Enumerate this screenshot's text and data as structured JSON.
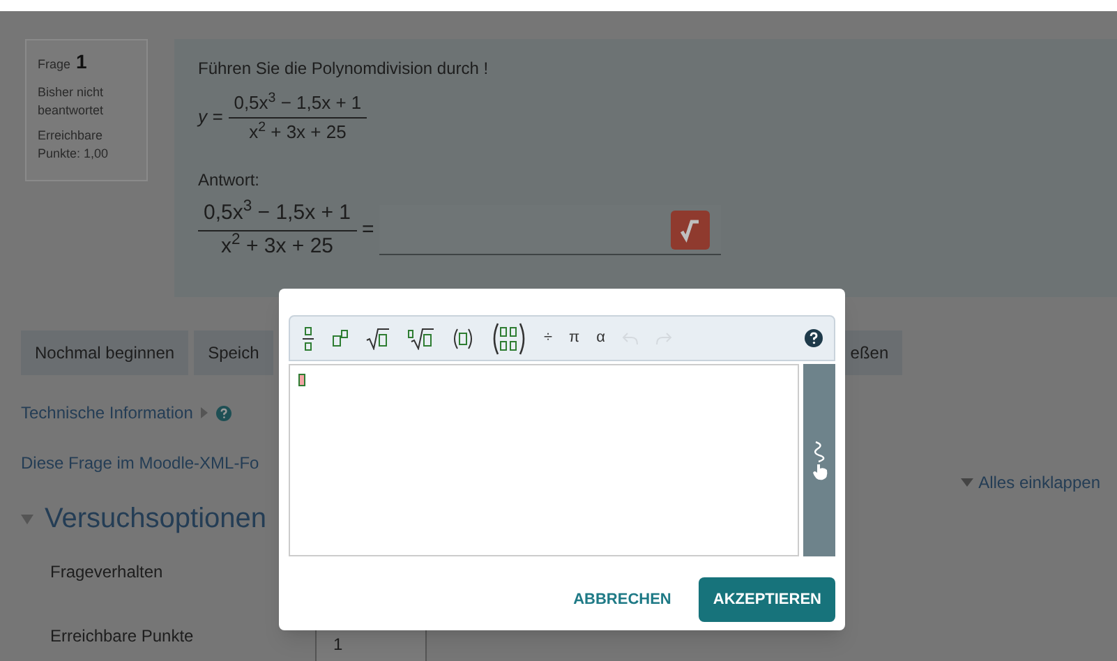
{
  "question_info": {
    "label": "Frage",
    "number": "1",
    "status": "Bisher nicht beantwortet",
    "points": "Erreichbare Punkte: 1,00"
  },
  "question": {
    "prompt": "Führen Sie die Polynomdivision durch !",
    "formula": {
      "lhs": "y =",
      "numerator": "0,5x$^{3}$ − 1,5x + 1",
      "denominator": "x$^{2}$ + 3x + 25"
    },
    "answer_label": "Antwort:",
    "answer_formula": {
      "numerator": "0,5x$^{3}$ − 1,5x + 1",
      "denominator": "x$^{2}$ + 3x + 25",
      "rhs": "="
    }
  },
  "action_buttons": [
    {
      "label": "Nochmal beginnen"
    },
    {
      "label": "Speich"
    },
    {
      "label": "eßen"
    }
  ],
  "links": [
    {
      "label": "Technische Information",
      "kind": "expander"
    },
    {
      "label": "Diese Frage im Moodle-XML-Fo",
      "kind": "plain"
    }
  ],
  "collapse_all": "Alles einklappen",
  "section": {
    "title": "Versuchsoptionen",
    "expanded": true,
    "fields": [
      {
        "label": "Frageverhalten",
        "kind": "hidden"
      },
      {
        "label": "Erreichbare Punkte",
        "kind": "input",
        "value": "1"
      }
    ]
  },
  "dialog": {
    "toolbar": [
      {
        "kind": "fraction",
        "disabled": false
      },
      {
        "kind": "power",
        "disabled": false
      },
      {
        "kind": "sqrt",
        "disabled": false
      },
      {
        "kind": "nthroot",
        "disabled": false
      },
      {
        "kind": "parens",
        "disabled": false
      },
      {
        "kind": "matrix",
        "disabled": false
      },
      {
        "kind": "char",
        "label": "÷",
        "disabled": false
      },
      {
        "kind": "char",
        "label": "π",
        "disabled": false
      },
      {
        "kind": "char",
        "label": "α",
        "disabled": false
      },
      {
        "kind": "undo",
        "disabled": true
      },
      {
        "kind": "redo",
        "disabled": true
      }
    ],
    "buttons": [
      {
        "label": "ABBRECHEN",
        "kind": "text"
      },
      {
        "label": "AKZEPTIEREN",
        "kind": "primary"
      }
    ]
  }
}
